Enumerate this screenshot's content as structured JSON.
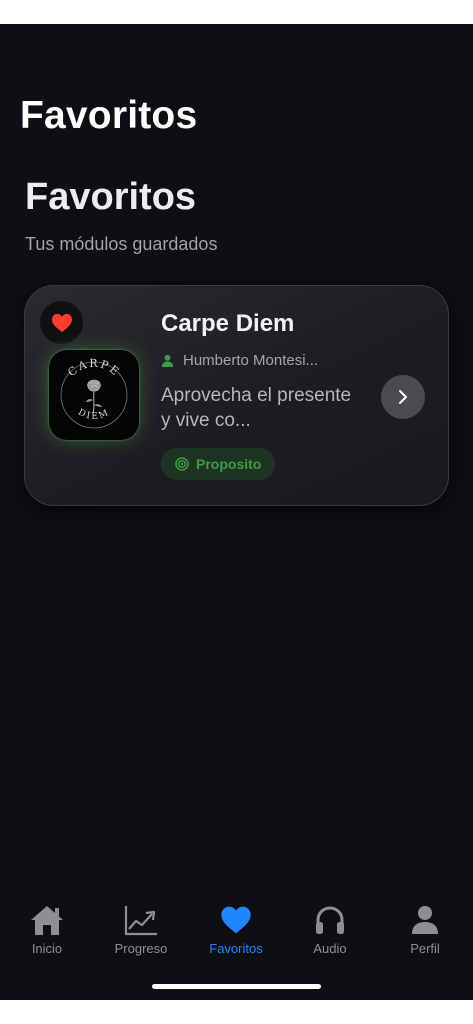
{
  "header": {
    "nav_title": "Favoritos"
  },
  "page": {
    "title": "Favoritos",
    "subtitle": "Tus módulos guardados"
  },
  "favorites": [
    {
      "title": "Carpe Diem",
      "author": "Humberto Montesi...",
      "description": "Aprovecha el presente y vive co...",
      "tag": "Proposito",
      "cover_text": {
        "top": "CARPE",
        "bottom": "DIEM"
      },
      "favorited": true
    }
  ],
  "tabbar": {
    "items": [
      {
        "label": "Inicio",
        "icon": "house-icon",
        "active": false
      },
      {
        "label": "Progreso",
        "icon": "chart-icon",
        "active": false
      },
      {
        "label": "Favoritos",
        "icon": "heart-icon",
        "active": true
      },
      {
        "label": "Audio",
        "icon": "headphones-icon",
        "active": false
      },
      {
        "label": "Perfil",
        "icon": "person-icon",
        "active": false
      }
    ]
  },
  "colors": {
    "background": "#0e0e13",
    "accent": "#1f86ff",
    "favorite": "#ff3b30",
    "tag_green": "#3c9c48",
    "inactive": "#8e8e93"
  }
}
